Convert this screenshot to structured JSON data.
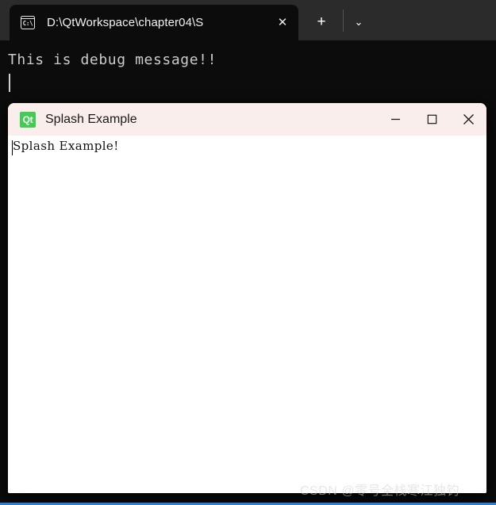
{
  "terminal": {
    "tab": {
      "icon": "command-prompt-icon",
      "icon_text": "C:\\",
      "title": "D:\\QtWorkspace\\chapter04\\S",
      "close_label": "✕"
    },
    "new_tab_label": "+",
    "dropdown_label": "⌄",
    "output_line": "This is debug message!!",
    "colors": {
      "tabbar_background": "#2b2b2b",
      "terminal_background": "#0c0c0c",
      "text": "#cccccc",
      "focus_line": "#2f7fd0"
    }
  },
  "qt_window": {
    "logo_text": "Qt",
    "title": "Splash Example",
    "minimize_label": "Minimize",
    "maximize_label": "Maximize",
    "close_label": "Close",
    "content_text": "Splash Example!",
    "colors": {
      "titlebar": "#f9eeec",
      "client": "#ffffff",
      "logo_green": "#41cd52"
    }
  },
  "watermark": {
    "text": "CSDN @零号全栈寒江独钓"
  }
}
